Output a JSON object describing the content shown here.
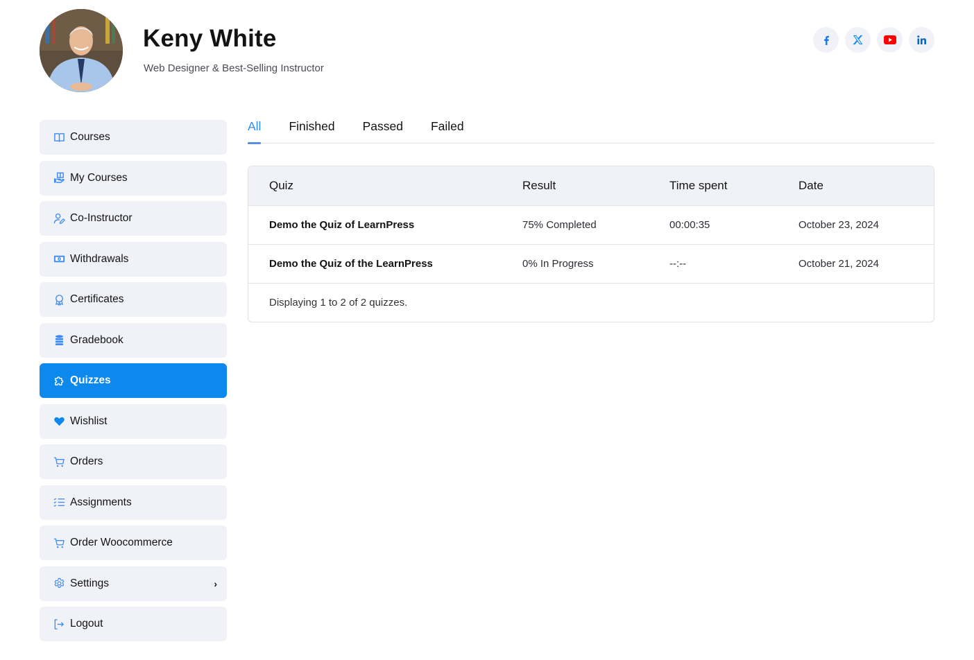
{
  "profile": {
    "name": "Keny White",
    "role": "Web Designer & Best-Selling Instructor",
    "avatar": "instructor-avatar-photo"
  },
  "socials": [
    {
      "name": "facebook",
      "icon": "facebook-icon",
      "color": "#1a73e8"
    },
    {
      "name": "x",
      "icon": "x-twitter-icon",
      "color": "#1a8cf0"
    },
    {
      "name": "youtube",
      "icon": "youtube-icon",
      "color": "#ff0000"
    },
    {
      "name": "linkedin",
      "icon": "linkedin-icon",
      "color": "#0a66c2"
    }
  ],
  "sidebar": {
    "items": [
      {
        "label": "Courses",
        "icon": "book-open-icon"
      },
      {
        "label": "My Courses",
        "icon": "my-courses-icon"
      },
      {
        "label": "Co-Instructor",
        "icon": "user-edit-icon"
      },
      {
        "label": "Withdrawals",
        "icon": "money-bill-icon"
      },
      {
        "label": "Certificates",
        "icon": "award-icon"
      },
      {
        "label": "Gradebook",
        "icon": "database-icon"
      },
      {
        "label": "Quizzes",
        "icon": "puzzle-icon",
        "active": true
      },
      {
        "label": "Wishlist",
        "icon": "heart-icon"
      },
      {
        "label": "Orders",
        "icon": "cart-icon"
      },
      {
        "label": "Assignments",
        "icon": "list-check-icon"
      },
      {
        "label": "Order Woocommerce",
        "icon": "cart-icon"
      },
      {
        "label": "Settings",
        "icon": "gear-icon",
        "has_submenu": true
      },
      {
        "label": "Logout",
        "icon": "logout-icon"
      }
    ],
    "active_color": "#0d88ec"
  },
  "tabs": [
    {
      "label": "All",
      "active": true
    },
    {
      "label": "Finished"
    },
    {
      "label": "Passed"
    },
    {
      "label": "Failed"
    }
  ],
  "table": {
    "headers": [
      "Quiz",
      "Result",
      "Time spent",
      "Date"
    ],
    "rows": [
      {
        "quiz": "Demo the Quiz of LearnPress",
        "result": "75% Completed",
        "time_spent": "00:00:35",
        "date": "October 23, 2024"
      },
      {
        "quiz": "Demo the Quiz of the LearnPress",
        "result": "0% In Progress",
        "time_spent": "--:--",
        "date": "October 21, 2024"
      }
    ],
    "footer": "Displaying 1 to 2 of 2 quizzes."
  },
  "accent_color": "#2d8ef0"
}
